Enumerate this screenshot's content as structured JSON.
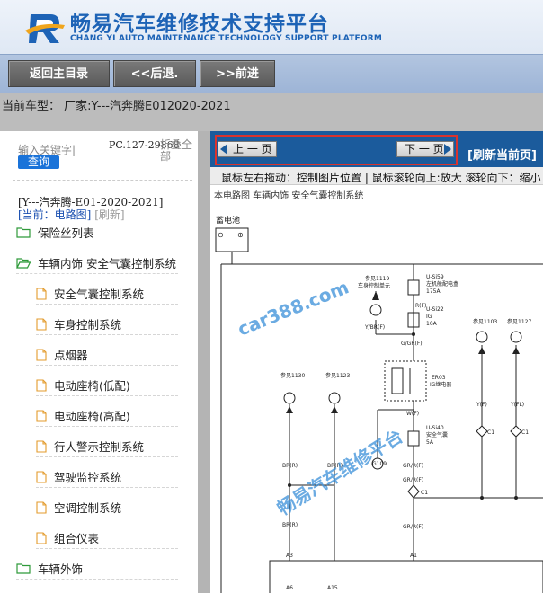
{
  "header": {
    "title": "畅易汽车维修技术支持平台",
    "subtitle": "CHANG YI AUTO MAINTENANCE TECHNOLOGY SUPPORT PLATFORM"
  },
  "toolbar": {
    "home_label": "返回主目录",
    "back_label": "<<后退.",
    "forward_label": ">>前进"
  },
  "model_bar": {
    "text": "当前车型： 厂家:Y---汽奔腾E012020-2021"
  },
  "search": {
    "placeholder": "输入关键字|",
    "button_label": "查询"
  },
  "code_label": "PC.127-29868",
  "collapse_label": "折叠全部",
  "path": {
    "model": "[Y---汽奔腾-E01-2020-2021]",
    "current": "[当前：电路图]",
    "refresh": "[刷新]"
  },
  "tree": [
    {
      "label": "保险丝列表",
      "type": "folder"
    },
    {
      "label": "车辆内饰 安全气囊控制系统",
      "type": "folder-open"
    },
    {
      "label": "安全气囊控制系统",
      "type": "doc"
    },
    {
      "label": "车身控制系统",
      "type": "doc"
    },
    {
      "label": "点烟器",
      "type": "doc"
    },
    {
      "label": "电动座椅(低配)",
      "type": "doc"
    },
    {
      "label": "电动座椅(高配)",
      "type": "doc"
    },
    {
      "label": "行人警示控制系统",
      "type": "doc"
    },
    {
      "label": "驾驶监控系统",
      "type": "doc"
    },
    {
      "label": "空调控制系统",
      "type": "doc"
    },
    {
      "label": "组合仪表",
      "type": "doc"
    },
    {
      "label": "车辆外饰",
      "type": "folder"
    }
  ],
  "viewer": {
    "prev_label": "上 一 页",
    "next_label": "下 一 页",
    "refresh_label": "[刷新当前页]",
    "hint": "鼠标左右拖动：控制图片位置 | 鼠标滚轮向上:放大  滚轮向下：缩小",
    "doc_title": "本电路图  车辆内饰  安全气囊控制系统"
  },
  "diagram": {
    "battery_label": "蓄电池",
    "fuse_1": {
      "ref": "参见1119",
      "desc": "车身控制单元",
      "name": "U-Si59",
      "sub": "左机舱配电盒",
      "rating": "175A"
    },
    "fuse_2": {
      "name": "U-Si22",
      "sub": "IG",
      "rating": "10A"
    },
    "fuse_3": {
      "name": "U-Si40",
      "sub": "安全气囊",
      "rating": "5A"
    },
    "relay": {
      "name": "ER03",
      "sub": "IG继电器"
    },
    "wire_labels": [
      "R(F)",
      "Y/BR(F)",
      "G/GR(F)",
      "W(F)",
      "GR/R(F)",
      "GR/R(F)",
      "GR/R(F)",
      "BR(R)",
      "BR(R)",
      "BR(R)",
      "Y(F)",
      "Y(FL)"
    ],
    "refs": [
      "参见1130",
      "参见1123",
      "参见1103",
      "参见1127"
    ],
    "connectors": [
      "C1",
      "C1",
      "C1"
    ],
    "pins": [
      "A3",
      "A1",
      "A6",
      "A15"
    ],
    "watermark_1": "car388.com",
    "watermark_2": "畅易汽车维修平台",
    "ground_label": "G109",
    "line_color": "#222222",
    "watermark_color": "#3a8fd8"
  },
  "colors": {
    "brand": "#1d63b6",
    "nav": "#1b5b9c",
    "highlight_frame": "#d9332e",
    "search_button": "#1a73d9"
  }
}
